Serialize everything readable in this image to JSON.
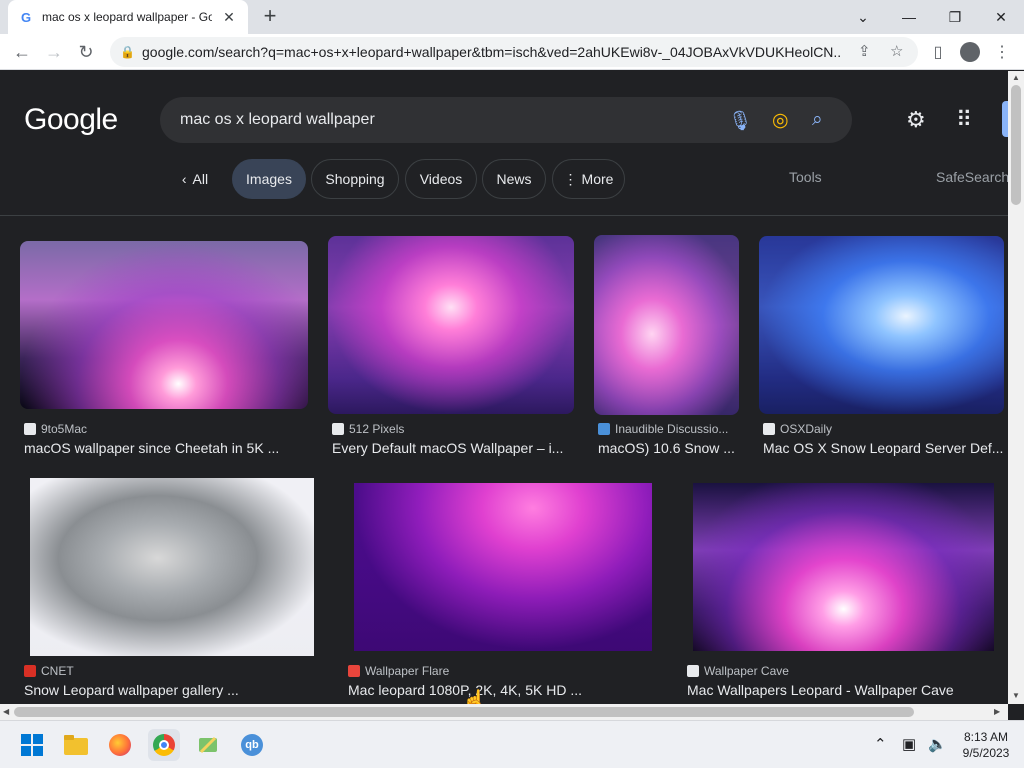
{
  "browser": {
    "tab_title": "mac os x leopard wallpaper - Go",
    "tab_close": "✕",
    "new_tab": "+",
    "url": "google.com/search?q=mac+os+x+leopard+wallpaper&tbm=isch&ved=2ahUKEwi8v-_04JOBAxVkVDUKHeolCN..."
  },
  "google": {
    "logo": "Google",
    "query": "mac os x leopard wallpaper"
  },
  "filters": {
    "all": "All",
    "images": "Images",
    "shopping": "Shopping",
    "videos": "Videos",
    "news": "News",
    "more": "More",
    "tools": "Tools",
    "safesearch": "SafeSearch"
  },
  "results": [
    {
      "source": "9to5Mac",
      "title": "macOS wallpaper since Cheetah in 5K ..."
    },
    {
      "source": "512 Pixels",
      "title": "Every Default macOS Wallpaper – i..."
    },
    {
      "source": "Inaudible Discussio...",
      "title": "macOS) 10.6 Snow ..."
    },
    {
      "source": "OSXDaily",
      "title": "Mac OS X Snow Leopard Server Def..."
    },
    {
      "source": "CNET",
      "title": "Snow Leopard wallpaper gallery ..."
    },
    {
      "source": "Wallpaper Flare",
      "title": "Mac leopard 1080P, 2K, 4K, 5K HD ..."
    },
    {
      "source": "Wallpaper Cave",
      "title": "Mac Wallpapers Leopard - Wallpaper Cave"
    }
  ],
  "taskbar": {
    "time": "8:13 AM",
    "date": "9/5/2023"
  }
}
